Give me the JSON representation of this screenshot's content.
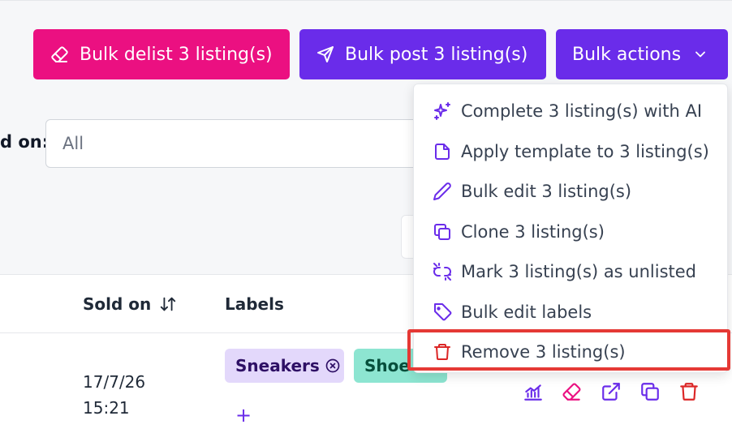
{
  "toolbar": {
    "bulk_delist_label": "Bulk delist 3 listing(s)",
    "bulk_post_label": "Bulk post 3 listing(s)",
    "bulk_actions_label": "Bulk actions"
  },
  "filter": {
    "label": "d on:",
    "value": "All"
  },
  "table": {
    "columns": {
      "sold_on": "Sold on",
      "labels": "Labels"
    },
    "row": {
      "sold_on_date": "17/7/26",
      "sold_on_time": "15:21",
      "labels": [
        "Sneakers",
        "Shoe"
      ],
      "add_label": "+"
    }
  },
  "menu": {
    "items": [
      {
        "label": "Complete 3 listing(s) with AI",
        "icon": "sparkles-icon"
      },
      {
        "label": "Apply template to 3 listing(s)",
        "icon": "document-icon"
      },
      {
        "label": "Bulk edit 3 listing(s)",
        "icon": "pencil-icon"
      },
      {
        "label": "Clone 3 listing(s)",
        "icon": "copy-icon"
      },
      {
        "label": "Mark 3 listing(s) as unlisted",
        "icon": "unlink-icon"
      },
      {
        "label": "Bulk edit labels",
        "icon": "tag-icon"
      },
      {
        "label": "Remove 3 listing(s)",
        "icon": "trash-icon"
      }
    ]
  },
  "colors": {
    "pink": "#eb1081",
    "purple": "#6a2cea",
    "danger": "#dc2626",
    "highlight": "#e53935"
  }
}
